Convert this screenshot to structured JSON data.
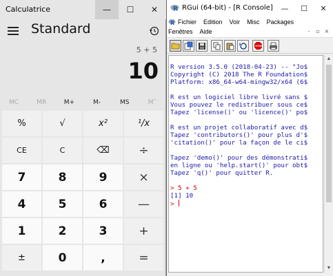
{
  "calculator": {
    "title": "Calculatrice",
    "window_controls": {
      "minimize": "—",
      "maximize": "☐",
      "close": "✕"
    },
    "mode": "Standard",
    "expression": "5 + 5",
    "display": "10",
    "memory": [
      "MC",
      "MR",
      "M+",
      "M-",
      "MS",
      "M˅"
    ],
    "keys": [
      {
        "label": "%"
      },
      {
        "label": "√"
      },
      {
        "label": "x²"
      },
      {
        "label": "¹/x"
      },
      {
        "label": "CE"
      },
      {
        "label": "C"
      },
      {
        "label": "⌫"
      },
      {
        "label": "÷"
      },
      {
        "label": "7"
      },
      {
        "label": "8"
      },
      {
        "label": "9"
      },
      {
        "label": "×"
      },
      {
        "label": "4"
      },
      {
        "label": "5"
      },
      {
        "label": "6"
      },
      {
        "label": "—"
      },
      {
        "label": "1"
      },
      {
        "label": "2"
      },
      {
        "label": "3"
      },
      {
        "label": "+"
      },
      {
        "label": "±"
      },
      {
        "label": "0"
      },
      {
        "label": ","
      },
      {
        "label": "="
      }
    ]
  },
  "rgui": {
    "title": "RGui (64-bit) - [R Console]",
    "window_controls": {
      "minimize": "—",
      "maximize": "☐",
      "close": "✕"
    },
    "menu_row1": [
      "Fichier",
      "Edition",
      "Voir",
      "Misc",
      "Packages"
    ],
    "menu_row2": [
      "Fenêtres",
      "Aide"
    ],
    "mdi_controls": [
      "-",
      "▫",
      "×"
    ],
    "console_lines": [
      {
        "text": "",
        "color": "blue"
      },
      {
        "text": "R version 3.5.0 (2018-04-23) -- \"Jo$",
        "color": "blue"
      },
      {
        "text": "Copyright (C) 2018 The R Foundation$",
        "color": "blue"
      },
      {
        "text": "Platform: x86_64-w64-mingw32/x64 (6$",
        "color": "blue"
      },
      {
        "text": "",
        "color": "blue"
      },
      {
        "text": "R est un logiciel libre livré sans $",
        "color": "blue"
      },
      {
        "text": "Vous pouvez le redistribuer sous ce$",
        "color": "blue"
      },
      {
        "text": "Tapez 'license()' ou 'licence()' po$",
        "color": "blue"
      },
      {
        "text": "",
        "color": "blue"
      },
      {
        "text": "R est un projet collaboratif avec d$",
        "color": "blue"
      },
      {
        "text": "Tapez 'contributors()' pour plus d'$",
        "color": "blue"
      },
      {
        "text": "'citation()' pour la façon de le ci$",
        "color": "blue"
      },
      {
        "text": "",
        "color": "blue"
      },
      {
        "text": "Tapez 'demo()' pour des démonstrati$",
        "color": "blue"
      },
      {
        "text": "en ligne ou 'help.start()' pour obt$",
        "color": "blue"
      },
      {
        "text": "Tapez 'q()' pour quitter R.",
        "color": "blue"
      },
      {
        "text": "",
        "color": "blue"
      },
      {
        "text": "> 5 + 5",
        "color": "red"
      },
      {
        "text": "[1] 10",
        "color": "blue"
      },
      {
        "text": "> ",
        "color": "red"
      }
    ]
  }
}
